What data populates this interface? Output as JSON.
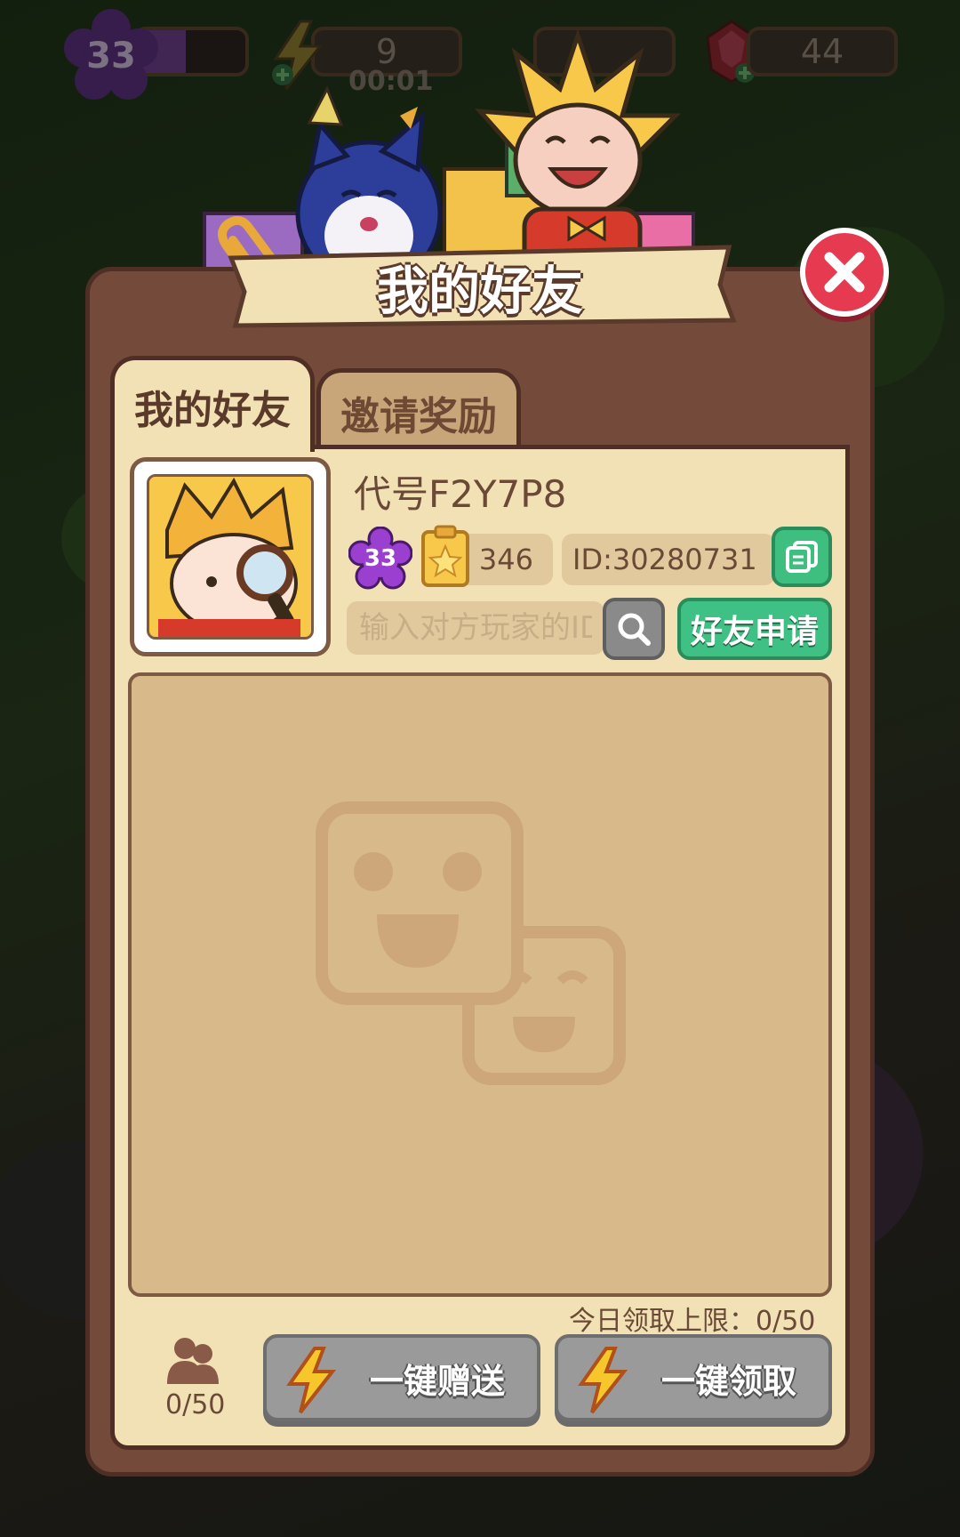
{
  "hud": {
    "level": "33",
    "energy": "9",
    "timer": "00:01",
    "gems": "44"
  },
  "dialog": {
    "title": "我的好友",
    "tabs": [
      "我的好友",
      "邀请奖励"
    ],
    "active_tab": 0
  },
  "player": {
    "name": "代号F2Y7P8",
    "level": "33",
    "score": "346",
    "id": "ID:30280731"
  },
  "search": {
    "placeholder": "输入对方玩家的ID",
    "apply_label": "好友申请"
  },
  "footer": {
    "daily_limit": "今日领取上限：0/50",
    "friend_count": "0/50",
    "send_all_label": "一键赠送",
    "claim_all_label": "一键领取"
  },
  "colors": {
    "panel": "#744a3b",
    "content": "#f2e1b5",
    "accent_green": "#3fc185",
    "close_red": "#e53a4f"
  }
}
